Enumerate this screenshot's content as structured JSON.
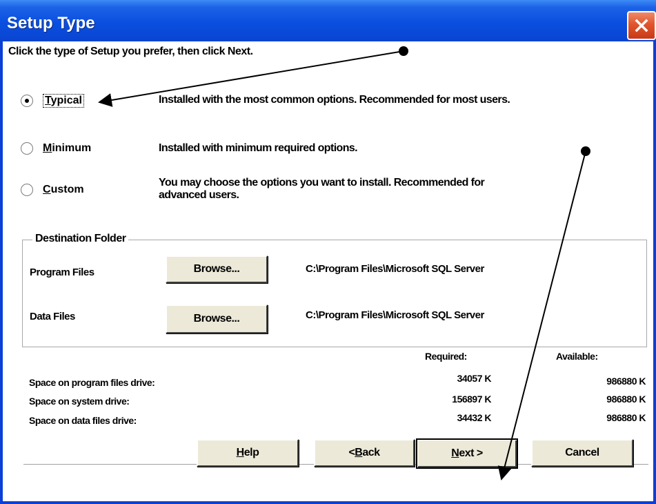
{
  "window": {
    "title": "Setup Type"
  },
  "instruction": "Click the type of Setup you prefer, then click Next.",
  "options": [
    {
      "label_underlined": "T",
      "label_rest": "ypical",
      "description": "Installed with the most common options. Recommended for most users.",
      "selected": true
    },
    {
      "label_underlined": "M",
      "label_rest": "inimum",
      "description": "Installed with minimum required options.",
      "selected": false
    },
    {
      "label_underlined": "C",
      "label_rest": "ustom",
      "description_line1": "You may choose the options you want to install. Recommended for",
      "description_line2": "advanced users.",
      "selected": false
    }
  ],
  "destination": {
    "legend": "Destination Folder",
    "program_files_label": "Program Files",
    "data_files_label": "Data Files",
    "browse_label": "Browse...",
    "program_files_path": "C:\\Program Files\\Microsoft SQL Server",
    "data_files_path": "C:\\Program Files\\Microsoft SQL Server"
  },
  "space": {
    "required_header": "Required:",
    "available_header": "Available:",
    "rows": [
      {
        "label": "Space on program files drive:",
        "required": "34057 K",
        "available": "986880 K"
      },
      {
        "label": "Space on system drive:",
        "required": "156897 K",
        "available": "986880 K"
      },
      {
        "label": "Space on data files drive:",
        "required": "34432 K",
        "available": "986880 K"
      }
    ]
  },
  "buttons": {
    "help_underlined": "H",
    "help_rest": "elp",
    "back_prefix": "< ",
    "back_underlined": "B",
    "back_rest": "ack",
    "next_underlined": "N",
    "next_rest": "ext >",
    "cancel": "Cancel"
  },
  "colors": {
    "titlebar": "#0a4fe0",
    "close_button": "#e0552d",
    "button_face": "#ece9d8"
  }
}
